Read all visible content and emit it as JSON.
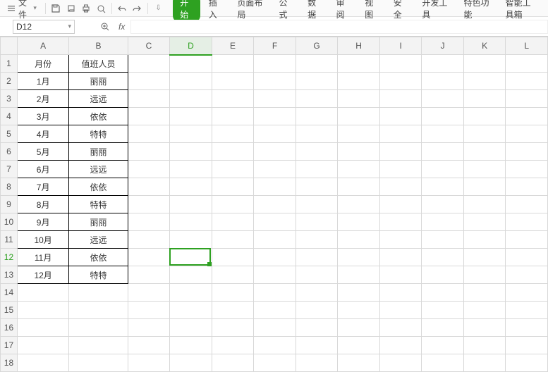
{
  "qat": {
    "file_label": "文件"
  },
  "tabs": {
    "start": "开始",
    "insert": "插入",
    "pagelayout": "页面布局",
    "formula": "公式",
    "data": "数据",
    "review": "审阅",
    "view": "视图",
    "security": "安全",
    "devtools": "开发工具",
    "special": "特色功能",
    "aitools": "智能工具箱"
  },
  "namebox": {
    "cell_ref": "D12"
  },
  "fx": {
    "label": "fx",
    "value": ""
  },
  "columns": [
    "A",
    "B",
    "C",
    "D",
    "E",
    "F",
    "G",
    "H",
    "I",
    "J",
    "K",
    "L"
  ],
  "active": {
    "col": "D",
    "row": 12
  },
  "table": {
    "col_a_header": "月份",
    "col_b_header": "值班人员",
    "rows": [
      {
        "month": "1月",
        "staff": "丽丽"
      },
      {
        "month": "2月",
        "staff": "远远"
      },
      {
        "month": "3月",
        "staff": "依依"
      },
      {
        "month": "4月",
        "staff": "特特"
      },
      {
        "month": "5月",
        "staff": "丽丽"
      },
      {
        "month": "6月",
        "staff": "远远"
      },
      {
        "month": "7月",
        "staff": "依依"
      },
      {
        "month": "8月",
        "staff": "特特"
      },
      {
        "month": "9月",
        "staff": "丽丽"
      },
      {
        "month": "10月",
        "staff": "远远"
      },
      {
        "month": "11月",
        "staff": "依依"
      },
      {
        "month": "12月",
        "staff": "特特"
      }
    ]
  }
}
